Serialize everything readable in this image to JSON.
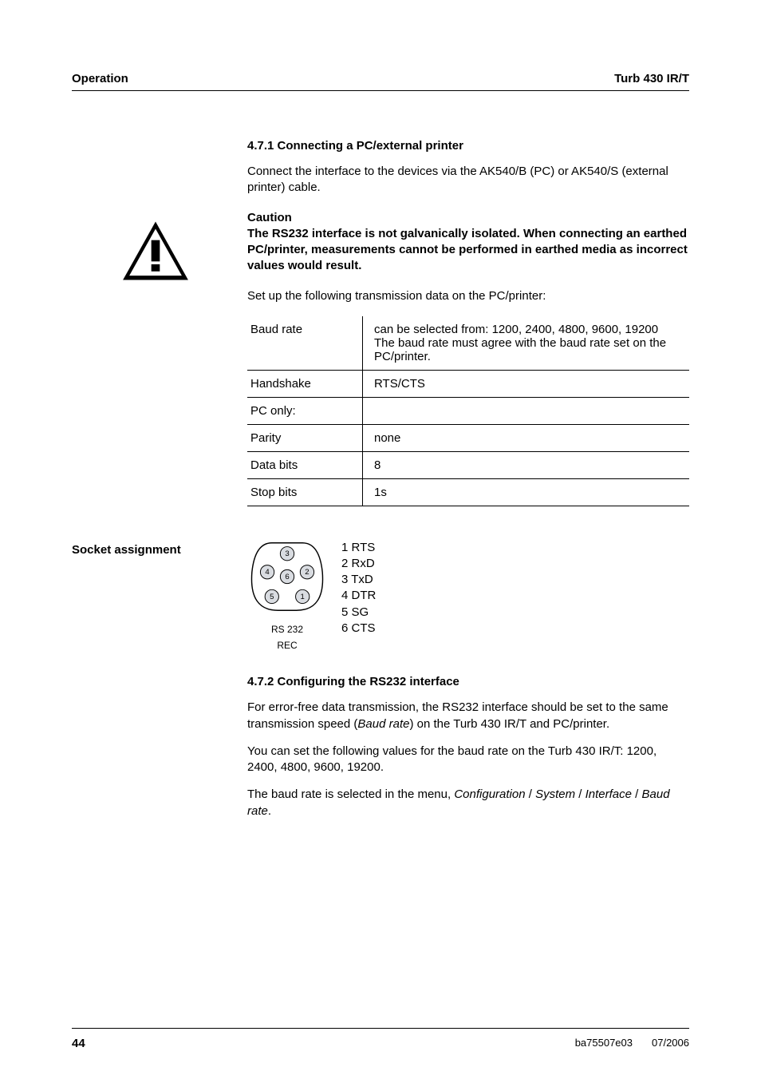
{
  "header": {
    "left": "Operation",
    "right": "Turb 430 IR/T"
  },
  "section471": {
    "number_title": "4.7.1   Connecting a PC/external printer",
    "intro": "Connect the interface to the devices via the AK540/B (PC) or AK540/S (external printer) cable."
  },
  "caution": {
    "head": "Caution",
    "body": "The RS232 interface is not galvanically isolated. When connecting an earthed PC/printer, measurements cannot be performed in earthed media as incorrect values would result."
  },
  "trans_intro": "Set up the following transmission data on the PC/printer:",
  "trans_table": [
    {
      "k": "Baud rate",
      "v": "can be selected from: 1200, 2400, 4800, 9600, 19200\nThe baud rate must agree with the baud rate set on the PC/printer."
    },
    {
      "k": "Handshake",
      "v": "RTS/CTS"
    },
    {
      "k": "PC only:",
      "v": ""
    },
    {
      "k": "Parity",
      "v": "none"
    },
    {
      "k": "Data bits",
      "v": "8"
    },
    {
      "k": "Stop bits",
      "v": "1s"
    }
  ],
  "socket": {
    "side_label": "Socket assignment",
    "caption1": "RS 232",
    "caption2": "REC",
    "pins": [
      "1 RTS",
      "2 RxD",
      "3 TxD",
      "4 DTR",
      "5 SG",
      "6 CTS"
    ],
    "pin_numbers": [
      "1",
      "2",
      "3",
      "4",
      "5",
      "6"
    ]
  },
  "section472": {
    "number_title": "4.7.2   Configuring the RS232 interface",
    "p1_a": "For error-free data transmission, the RS232 interface should be set to the same transmission speed (",
    "p1_i": "Baud rate",
    "p1_b": ") on the Turb 430 IR/T and PC/printer.",
    "p2": "You can set the following values for the baud rate on the Turb 430 IR/T: 1200, 2400, 4800, 9600, 19200.",
    "p3_a": "The baud rate is selected in the menu, ",
    "p3_i1": "Configuration",
    "p3_s1": " / ",
    "p3_i2": "System",
    "p3_s2": " / ",
    "p3_i3": "Interface",
    "p3_s3": " / ",
    "p3_i4": "Baud rate",
    "p3_b": "."
  },
  "footer": {
    "page": "44",
    "doc": "ba75507e03",
    "date": "07/2006"
  }
}
